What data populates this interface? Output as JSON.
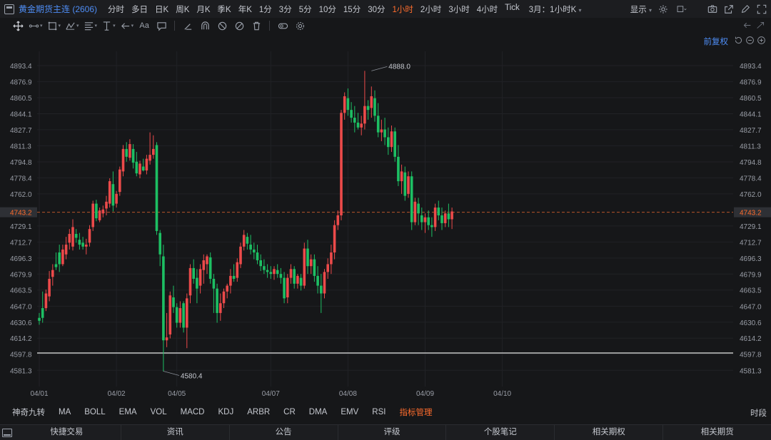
{
  "header": {
    "symbol": "黄金期货主连 (2606)",
    "periods": [
      "分时",
      "多日",
      "日K",
      "周K",
      "月K",
      "季K",
      "年K",
      "1分",
      "3分",
      "5分",
      "10分",
      "15分",
      "30分",
      "1小时",
      "2小时",
      "3小时",
      "4小时",
      "Tick"
    ],
    "active_period": "1小时",
    "contract_select": "3月：1小时K",
    "display_label": "显示",
    "icons": [
      "settings-icon",
      "square-icon",
      "camera-icon",
      "share-icon",
      "edit-icon",
      "fullscreen-icon"
    ]
  },
  "toolbar": {
    "font_label": "Aa",
    "icons": [
      "crosshair-icon",
      "line-icon",
      "rect-icon",
      "pattern-icon",
      "fib-icon",
      "vertical-icon",
      "arrow-icon",
      "text-icon",
      "note-icon",
      "eraser-icon",
      "magnet-icon",
      "lock-icon",
      "hide-icon",
      "trash-icon",
      "eye-icon",
      "gear-icon"
    ]
  },
  "subbar": {
    "adjust_label": "前复权"
  },
  "chart_data": {
    "type": "candlestick",
    "y_ticks": [
      "4893.4",
      "4876.9",
      "4860.5",
      "4844.1",
      "4827.7",
      "4811.3",
      "4794.8",
      "4778.4",
      "4762.0",
      "4729.1",
      "4712.7",
      "4696.3",
      "4679.9",
      "4663.5",
      "4647.0",
      "4630.6",
      "4614.2",
      "4597.8",
      "4581.3"
    ],
    "y_tick_values": [
      4893.4,
      4876.9,
      4860.5,
      4844.1,
      4827.7,
      4811.3,
      4794.8,
      4778.4,
      4762.0,
      4729.1,
      4712.7,
      4696.3,
      4679.9,
      4663.5,
      4647.0,
      4630.6,
      4614.2,
      4597.8,
      4581.3
    ],
    "ylim": [
      4572,
      4908
    ],
    "x_labels": [
      "04/01",
      "04/02",
      "04/05",
      "04/07",
      "04/08",
      "04/09",
      "04/10"
    ],
    "x_label_positions": [
      0,
      23,
      41,
      69,
      92,
      115,
      138
    ],
    "current_price": "4743.2",
    "current_price_value": 4743.2,
    "horizontal_line_value": 4599,
    "max_label": "4888.0",
    "max_value": 4888.0,
    "max_index": 99,
    "min_label": "4580.4",
    "min_value": 4580.4,
    "min_index": 37,
    "up_color": "#ec4a4a",
    "down_color": "#1dbf63",
    "candles": [
      [
        4635,
        4640,
        4628,
        4632
      ],
      [
        4645,
        4662,
        4630,
        4635
      ],
      [
        4645,
        4664,
        4642,
        4660
      ],
      [
        4657,
        4683,
        4652,
        4675
      ],
      [
        4677,
        4690,
        4668,
        4684
      ],
      [
        4690,
        4702,
        4684,
        4687
      ],
      [
        4702,
        4710,
        4682,
        4690
      ],
      [
        4690,
        4710,
        4688,
        4705
      ],
      [
        4700,
        4718,
        4695,
        4710
      ],
      [
        4712,
        4726,
        4705,
        4721
      ],
      [
        4708,
        4736,
        4704,
        4728
      ],
      [
        4721,
        4726,
        4712,
        4717
      ],
      [
        4715,
        4722,
        4705,
        4710
      ],
      [
        4712,
        4718,
        4705,
        4708
      ],
      [
        4708,
        4716,
        4700,
        4710
      ],
      [
        4712,
        4730,
        4708,
        4726
      ],
      [
        4728,
        4755,
        4724,
        4752
      ],
      [
        4752,
        4756,
        4734,
        4737
      ],
      [
        4735,
        4748,
        4733,
        4745
      ],
      [
        4742,
        4750,
        4738,
        4746
      ],
      [
        4747,
        4760,
        4740,
        4754
      ],
      [
        4752,
        4778,
        4748,
        4775
      ],
      [
        4772,
        4785,
        4744,
        4750
      ],
      [
        4752,
        4765,
        4748,
        4762
      ],
      [
        4764,
        4790,
        4760,
        4787
      ],
      [
        4785,
        4812,
        4780,
        4808
      ],
      [
        4808,
        4815,
        4795,
        4800
      ],
      [
        4799,
        4818,
        4796,
        4813
      ],
      [
        4808,
        4813,
        4788,
        4794
      ],
      [
        4795,
        4805,
        4780,
        4783
      ],
      [
        4782,
        4796,
        4778,
        4793
      ],
      [
        4790,
        4798,
        4785,
        4786
      ],
      [
        4786,
        4802,
        4782,
        4798
      ],
      [
        4796,
        4825,
        4792,
        4802
      ],
      [
        4802,
        4822,
        4798,
        4808
      ],
      [
        4812,
        4815,
        4720,
        4724
      ],
      [
        4722,
        4725,
        4688,
        4700
      ],
      [
        4698,
        4710,
        4580,
        4612
      ],
      [
        4612,
        4640,
        4605,
        4615
      ],
      [
        4618,
        4662,
        4614,
        4658
      ],
      [
        4656,
        4668,
        4640,
        4646
      ],
      [
        4646,
        4650,
        4625,
        4630
      ],
      [
        4630,
        4652,
        4625,
        4645
      ],
      [
        4650,
        4652,
        4620,
        4625
      ],
      [
        4625,
        4660,
        4604,
        4655
      ],
      [
        4658,
        4690,
        4650,
        4686
      ],
      [
        4686,
        4695,
        4670,
        4675
      ],
      [
        4676,
        4685,
        4650,
        4665
      ],
      [
        4668,
        4690,
        4660,
        4685
      ],
      [
        4684,
        4700,
        4670,
        4694
      ],
      [
        4690,
        4700,
        4680,
        4698
      ],
      [
        4697,
        4702,
        4670,
        4675
      ],
      [
        4675,
        4680,
        4640,
        4665
      ],
      [
        4665,
        4670,
        4630,
        4640
      ],
      [
        4640,
        4660,
        4632,
        4650
      ],
      [
        4650,
        4665,
        4645,
        4662
      ],
      [
        4662,
        4670,
        4655,
        4668
      ],
      [
        4668,
        4685,
        4660,
        4678
      ],
      [
        4678,
        4690,
        4672,
        4675
      ],
      [
        4676,
        4696,
        4672,
        4692
      ],
      [
        4690,
        4712,
        4686,
        4708
      ],
      [
        4708,
        4725,
        4704,
        4720
      ],
      [
        4718,
        4722,
        4705,
        4711
      ],
      [
        4710,
        4720,
        4700,
        4705
      ],
      [
        4705,
        4712,
        4695,
        4702
      ],
      [
        4702,
        4710,
        4690,
        4694
      ],
      [
        4694,
        4700,
        4683,
        4688
      ],
      [
        4688,
        4695,
        4680,
        4684
      ],
      [
        4684,
        4690,
        4676,
        4682
      ],
      [
        4682,
        4688,
        4675,
        4680
      ],
      [
        4680,
        4688,
        4674,
        4685
      ],
      [
        4684,
        4690,
        4676,
        4680
      ],
      [
        4680,
        4686,
        4670,
        4676
      ],
      [
        4676,
        4682,
        4650,
        4655
      ],
      [
        4656,
        4680,
        4650,
        4676
      ],
      [
        4676,
        4690,
        4670,
        4685
      ],
      [
        4685,
        4688,
        4665,
        4670
      ],
      [
        4670,
        4680,
        4665,
        4678
      ],
      [
        4676,
        4680,
        4663,
        4668
      ],
      [
        4668,
        4712,
        4665,
        4706
      ],
      [
        4706,
        4715,
        4680,
        4688
      ],
      [
        4688,
        4700,
        4680,
        4695
      ],
      [
        4695,
        4700,
        4672,
        4678
      ],
      [
        4678,
        4688,
        4660,
        4668
      ],
      [
        4668,
        4680,
        4640,
        4660
      ],
      [
        4660,
        4685,
        4655,
        4682
      ],
      [
        4682,
        4696,
        4675,
        4690
      ],
      [
        4690,
        4710,
        4680,
        4702
      ],
      [
        4702,
        4735,
        4695,
        4730
      ],
      [
        4730,
        4745,
        4725,
        4740
      ],
      [
        4740,
        4848,
        4735,
        4845
      ],
      [
        4845,
        4866,
        4838,
        4862
      ],
      [
        4860,
        4870,
        4842,
        4848
      ],
      [
        4848,
        4856,
        4835,
        4840
      ],
      [
        4840,
        4852,
        4825,
        4835
      ],
      [
        4835,
        4845,
        4828,
        4830
      ],
      [
        4830,
        4842,
        4822,
        4834
      ],
      [
        4834,
        4888,
        4828,
        4852
      ],
      [
        4852,
        4858,
        4838,
        4848
      ],
      [
        4850,
        4872,
        4840,
        4862
      ],
      [
        4860,
        4868,
        4836,
        4842
      ],
      [
        4842,
        4855,
        4820,
        4825
      ],
      [
        4825,
        4838,
        4816,
        4828
      ],
      [
        4828,
        4840,
        4812,
        4820
      ],
      [
        4820,
        4830,
        4802,
        4810
      ],
      [
        4810,
        4832,
        4805,
        4826
      ],
      [
        4826,
        4830,
        4795,
        4800
      ],
      [
        4800,
        4812,
        4770,
        4775
      ],
      [
        4775,
        4792,
        4762,
        4785
      ],
      [
        4784,
        4790,
        4755,
        4760
      ],
      [
        4762,
        4785,
        4758,
        4780
      ],
      [
        4780,
        4785,
        4725,
        4733
      ],
      [
        4733,
        4758,
        4730,
        4754
      ],
      [
        4752,
        4758,
        4730,
        4742
      ],
      [
        4740,
        4748,
        4725,
        4733
      ],
      [
        4733,
        4742,
        4722,
        4738
      ],
      [
        4738,
        4745,
        4725,
        4730
      ],
      [
        4730,
        4738,
        4718,
        4728
      ],
      [
        4728,
        4752,
        4724,
        4748
      ],
      [
        4748,
        4755,
        4735,
        4740
      ],
      [
        4740,
        4748,
        4725,
        4732
      ],
      [
        4732,
        4745,
        4728,
        4742
      ],
      [
        4742,
        4752,
        4728,
        4736
      ],
      [
        4736,
        4748,
        4726,
        4744
      ]
    ]
  },
  "indicators": {
    "items": [
      "神奇九转",
      "MA",
      "BOLL",
      "EMA",
      "VOL",
      "MACD",
      "KDJ",
      "ARBR",
      "CR",
      "DMA",
      "EMV",
      "RSI",
      "指标管理"
    ],
    "time_label": "时段"
  },
  "bottombar": {
    "items": [
      "快捷交易",
      "资讯",
      "公告",
      "评级",
      "个股笔记",
      "相关期权",
      "相关期货"
    ]
  }
}
